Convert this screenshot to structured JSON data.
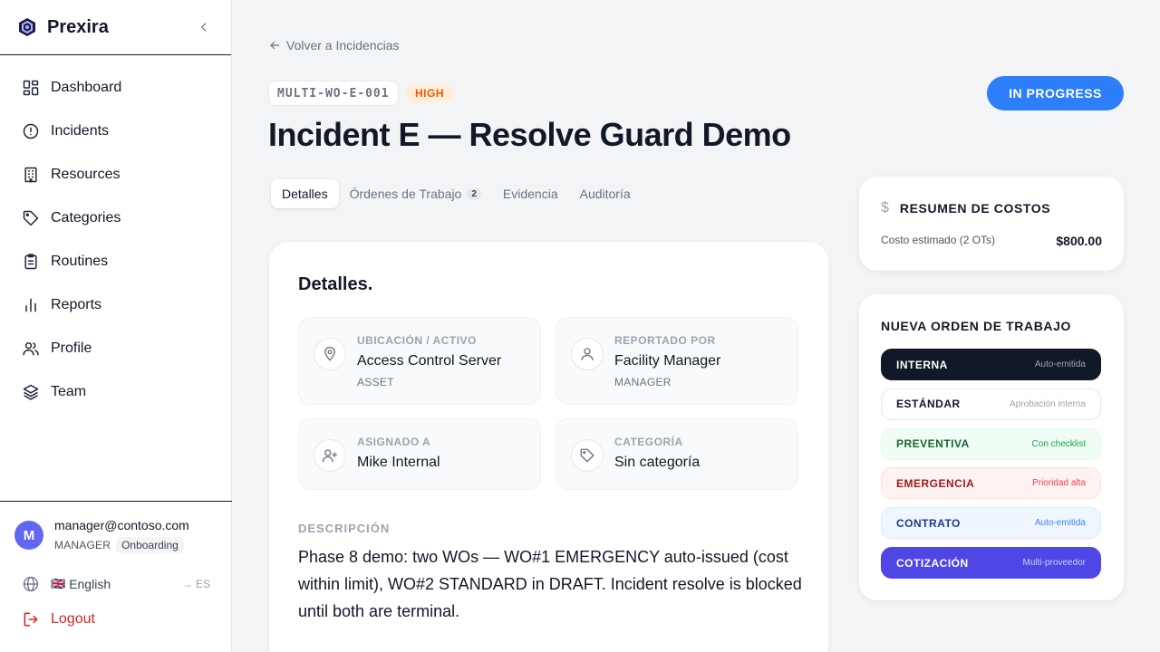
{
  "app": {
    "name": "Prexira"
  },
  "sidebar": {
    "items": [
      {
        "label": "Dashboard"
      },
      {
        "label": "Incidents"
      },
      {
        "label": "Resources"
      },
      {
        "label": "Categories"
      },
      {
        "label": "Routines"
      },
      {
        "label": "Reports"
      },
      {
        "label": "Profile"
      },
      {
        "label": "Team"
      }
    ]
  },
  "user": {
    "initial": "M",
    "email": "manager@contoso.com",
    "role": "MANAGER",
    "badge": "Onboarding"
  },
  "language": {
    "flag": "🇬🇧",
    "label": "English",
    "switch": "→ ES"
  },
  "logout": {
    "label": "Logout"
  },
  "incident": {
    "back_label": "Volver a Incidencias",
    "code": "MULTI-WO-E-001",
    "priority": "HIGH",
    "status": "IN PROGRESS",
    "title": "Incident E — Resolve Guard Demo"
  },
  "tabs": [
    {
      "label": "Detalles"
    },
    {
      "label": "Órdenes de Trabajo",
      "count": "2"
    },
    {
      "label": "Evidencia"
    },
    {
      "label": "Auditoría"
    }
  ],
  "details": {
    "title": "Detalles.",
    "location": {
      "label": "UBICACIÓN / ACTIVO",
      "value": "Access Control Server",
      "sub": "ASSET"
    },
    "reporter": {
      "label": "REPORTADO POR",
      "value": "Facility Manager",
      "sub": "MANAGER"
    },
    "assignee": {
      "label": "ASIGNADO A",
      "value": "Mike Internal"
    },
    "category": {
      "label": "CATEGORÍA",
      "value": "Sin categoría"
    },
    "description_label": "DESCRIPCIÓN",
    "description": "Phase 8 demo: two WOs — WO#1 EMERGENCY auto-issued (cost within limit), WO#2 STANDARD in DRAFT. Incident resolve is blocked until both are terminal."
  },
  "costs": {
    "title": "RESUMEN DE COSTOS",
    "estimate_label": "Costo estimado (2 OTs)",
    "estimate_value": "$800.00"
  },
  "new_wo": {
    "title": "NUEVA ORDEN DE TRABAJO",
    "options": [
      {
        "name": "INTERNA",
        "hint": "Auto-emitida",
        "bg": "#111827",
        "fg": "#ffffff",
        "hint_fg": "#9ca3af",
        "border": "#111827"
      },
      {
        "name": "ESTÁNDAR",
        "hint": "Aprobación interna",
        "bg": "#ffffff",
        "fg": "#111827",
        "hint_fg": "#9ca3af",
        "border": "#e5e7eb"
      },
      {
        "name": "PREVENTIVA",
        "hint": "Con checklist",
        "bg": "#f0fdf4",
        "fg": "#166534",
        "hint_fg": "#16a34a",
        "border": "#dcfce7"
      },
      {
        "name": "EMERGENCIA",
        "hint": "Prioridad alta",
        "bg": "#fef2f2",
        "fg": "#991b1b",
        "hint_fg": "#ef4444",
        "border": "#fee2e2"
      },
      {
        "name": "CONTRATO",
        "hint": "Auto-emitida",
        "bg": "#eff6ff",
        "fg": "#1e3a8a",
        "hint_fg": "#3b82f6",
        "border": "#dbeafe"
      },
      {
        "name": "COTIZACIÓN",
        "hint": "Multi-proveedor",
        "bg": "#4f46e5",
        "fg": "#ffffff",
        "hint_fg": "#c7d2fe",
        "border": "#4f46e5"
      }
    ]
  },
  "colors": {
    "accent": "#2d7ff9",
    "danger": "#dc2626",
    "priority_bg": "#ffedd5",
    "priority_fg": "#ea580c"
  }
}
